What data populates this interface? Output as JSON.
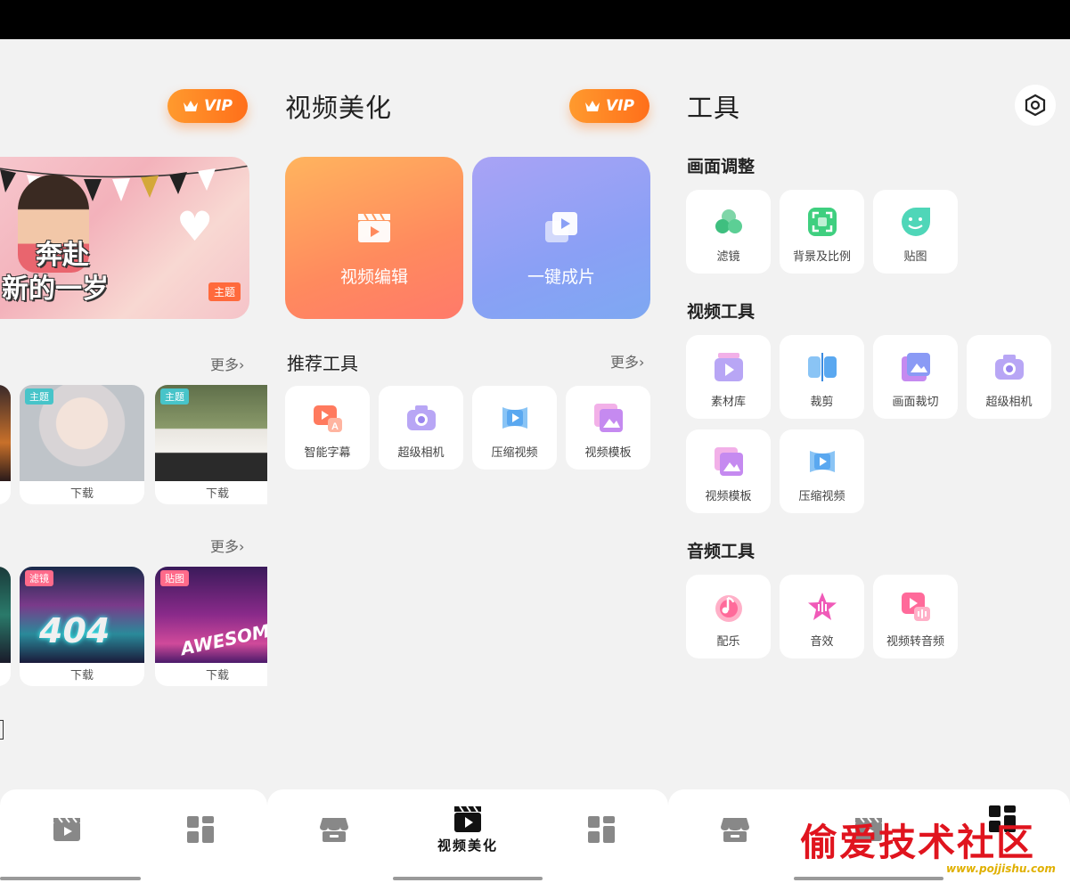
{
  "panel1": {
    "vip_label": "VIP",
    "banner": {
      "text_line1": "奔赴",
      "text_line2": "新的一岁",
      "tag": "主题"
    },
    "row1": {
      "more": "更多",
      "cards": [
        {
          "tag": "",
          "label": ""
        },
        {
          "tag": "主题",
          "label": "下载"
        },
        {
          "tag": "主题",
          "label": "下载"
        }
      ]
    },
    "row2": {
      "more": "更多",
      "cards": [
        {
          "tag": "",
          "label": ""
        },
        {
          "tag": "滤镜",
          "label": "下载",
          "overlay": "404"
        },
        {
          "tag": "贴图",
          "label": "下载",
          "overlay": "AWESOM"
        }
      ]
    }
  },
  "panel2": {
    "title": "视频美化",
    "vip_label": "VIP",
    "big_cards": [
      {
        "label": "视频编辑",
        "icon": "clapper-icon"
      },
      {
        "label": "一键成片",
        "icon": "stack-play-icon"
      }
    ],
    "recommend": {
      "title": "推荐工具",
      "more": "更多",
      "tools": [
        {
          "label": "智能字幕",
          "icon": "caption-icon"
        },
        {
          "label": "超级相机",
          "icon": "camera-icon"
        },
        {
          "label": "压缩视频",
          "icon": "compress-icon"
        },
        {
          "label": "视频模板",
          "icon": "template-icon"
        }
      ]
    },
    "nav_label": "视频美化"
  },
  "panel3": {
    "title": "工具",
    "sections": [
      {
        "title": "画面调整",
        "tools": [
          {
            "label": "滤镜",
            "icon": "filter-icon"
          },
          {
            "label": "背景及比例",
            "icon": "ratio-icon"
          },
          {
            "label": "贴图",
            "icon": "sticker-icon"
          }
        ]
      },
      {
        "title": "视频工具",
        "tools": [
          {
            "label": "素材库",
            "icon": "library-icon"
          },
          {
            "label": "裁剪",
            "icon": "trim-icon"
          },
          {
            "label": "画面裁切",
            "icon": "crop-icon"
          },
          {
            "label": "超级相机",
            "icon": "camera-icon"
          },
          {
            "label": "视频模板",
            "icon": "template-icon"
          },
          {
            "label": "压缩视频",
            "icon": "compress-icon"
          }
        ]
      },
      {
        "title": "音频工具",
        "tools": [
          {
            "label": "配乐",
            "icon": "music-icon"
          },
          {
            "label": "音效",
            "icon": "sound-effect-icon"
          },
          {
            "label": "视频转音频",
            "icon": "video-to-audio-icon"
          }
        ]
      }
    ]
  },
  "watermark": {
    "text": "偷爱技术社区",
    "url": "www.pojjishu.com"
  }
}
